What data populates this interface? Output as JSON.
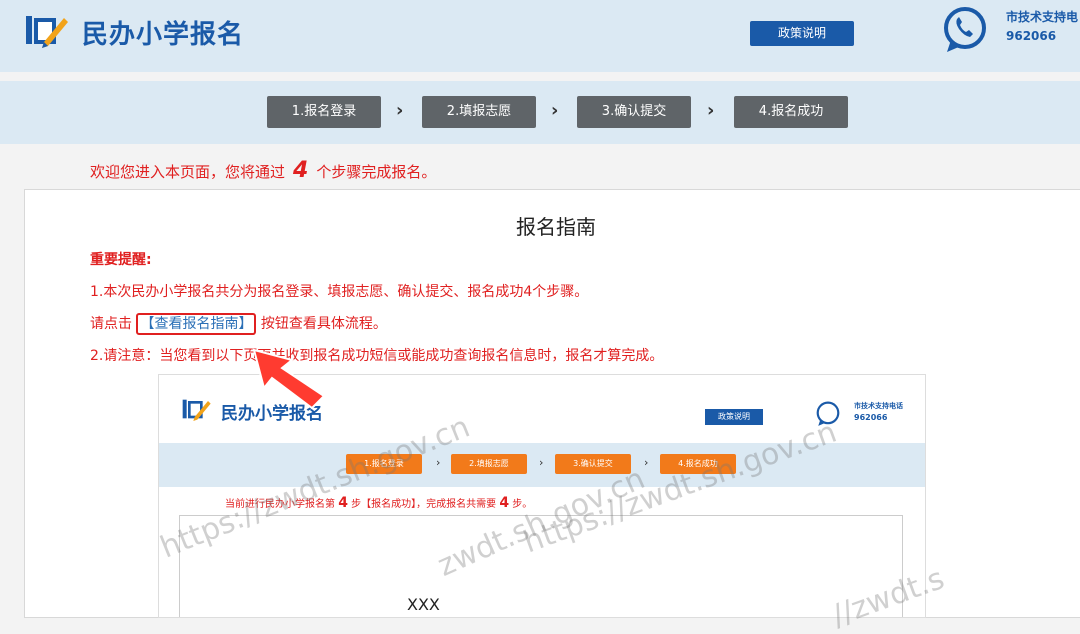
{
  "header": {
    "site_title": "民办小学报名",
    "policy_button": "政策说明",
    "support_label": "市技术支持电",
    "support_number": "962066"
  },
  "steps": [
    {
      "label": "1.报名登录"
    },
    {
      "label": "2.填报志愿"
    },
    {
      "label": "3.确认提交"
    },
    {
      "label": "4.报名成功"
    }
  ],
  "step_arrow": "›",
  "welcome": {
    "before": "欢迎您进入本页面，您将通过",
    "count": "4",
    "after": "个步骤完成报名。"
  },
  "guide": {
    "title": "报名指南",
    "important": "重要提醒:",
    "line1": "1.本次民办小学报名共分为报名登录、填报志愿、确认提交、报名成功4个步骤。",
    "line2_before": "请点击",
    "line2_link": "【查看报名指南】",
    "line2_after": "按钮查看具体流程。",
    "line3": "2.请注意：当您看到以下页面并收到报名成功短信或能成功查询报名信息时，报名才算完成。"
  },
  "preview": {
    "site_title": "民办小学报名",
    "policy_button": "政策说明",
    "support_label": "市技术支持电话",
    "support_number": "962066",
    "steps": [
      "1.报名登录",
      "2.填报志愿",
      "3.确认提交",
      "4.报名成功"
    ],
    "notice_before": "当前进行民办小学报名第",
    "notice_step": "4",
    "notice_mid": "步【报名成功】，完成报名共需要",
    "notice_total": "4",
    "notice_after": "步。",
    "placeholder_text": "XXX"
  },
  "watermarks": [
    "https://zwdt.sh.gov.cn",
    "zwdt.sh.gov.cn",
    "https://zwdt.sh.gov.cn",
    "//zwdt.s"
  ],
  "colors": {
    "brand_blue": "#1a5aa8",
    "header_bg": "#dbe9f3",
    "step_gray": "#5f6468",
    "alert_red": "#e02020",
    "step_orange": "#f27a1a"
  },
  "icons": {
    "logo": "book-pencil-icon",
    "phone": "phone-chat-icon",
    "pointer": "red-arrow-pointer-icon"
  }
}
